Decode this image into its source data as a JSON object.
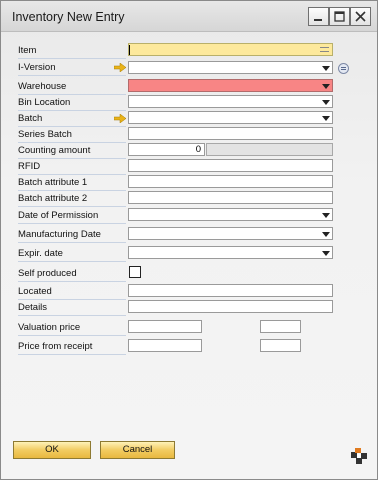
{
  "window": {
    "title": "Inventory New Entry"
  },
  "fields": {
    "item": "Item",
    "i_version": "I-Version",
    "warehouse": "Warehouse",
    "bin_location": "Bin Location",
    "batch": "Batch",
    "series_batch": "Series Batch",
    "counting_amount": "Counting amount",
    "counting_amount_value": "0",
    "rfid": "RFID",
    "batch_attribute_1": "Batch attribute 1",
    "batch_attribute_2": "Batch attribute 2",
    "date_of_permission": "Date of Permission",
    "manufacturing_date": "Manufacturing Date",
    "expir_date": "Expir. date",
    "self_produced": "Self produced",
    "located": "Located",
    "details": "Details",
    "valuation_price": "Valuation price",
    "price_from_receipt": "Price from receipt"
  },
  "buttons": {
    "ok": "OK",
    "cancel": "Cancel"
  },
  "colors": {
    "mandatory_field": "#fde99c",
    "error_field": "#f88585",
    "button": "#f2cc62"
  },
  "icons": [
    "minimize-icon",
    "maximize-icon",
    "close-icon",
    "link-arrow-icon",
    "dropdown-icon",
    "linked-object-icon",
    "app-logo-icon"
  ]
}
